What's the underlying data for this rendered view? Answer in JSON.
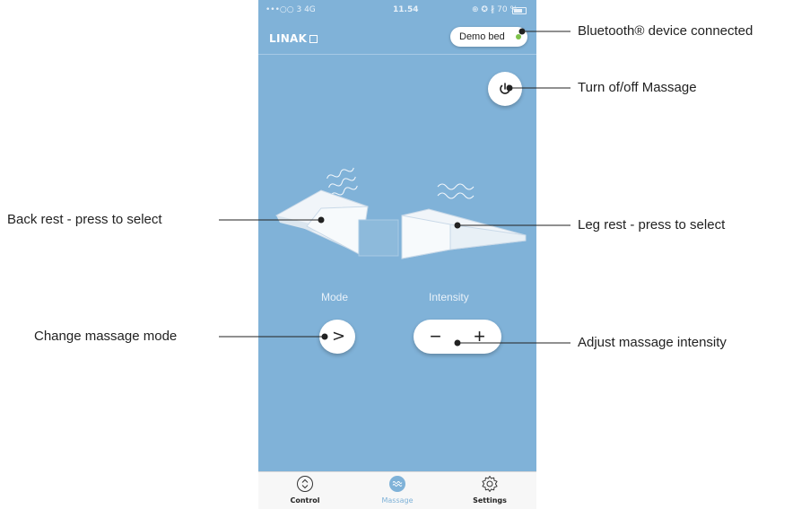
{
  "status_bar": {
    "signal": "•••○○ 3  4G",
    "time": "11.54",
    "right": "⊕ ✪ ∦ 70 %"
  },
  "app": {
    "logo": "LINAK",
    "device_name": "Demo bed",
    "device_status_color": "#7ec24a"
  },
  "controls": {
    "mode_label": "Mode",
    "mode_button": ">",
    "intensity_label": "Intensity",
    "decrease": "−",
    "increase": "+"
  },
  "tabs": [
    {
      "label": "Control",
      "icon": "chevron-up-down-circle-icon",
      "active": false
    },
    {
      "label": "Massage",
      "icon": "wave-circle-icon",
      "active": true
    },
    {
      "label": "Settings",
      "icon": "gear-icon",
      "active": false
    }
  ],
  "annotations": {
    "bluetooth": "Bluetooth® device connected",
    "power": "Turn of/off Massage",
    "back_rest": "Back rest - press to select",
    "leg_rest": "Leg rest - press to select",
    "mode": "Change massage mode",
    "intensity": "Adjust massage intensity"
  },
  "colors": {
    "screen_bg": "#80b2d8",
    "accent": "#7fb2d8"
  }
}
